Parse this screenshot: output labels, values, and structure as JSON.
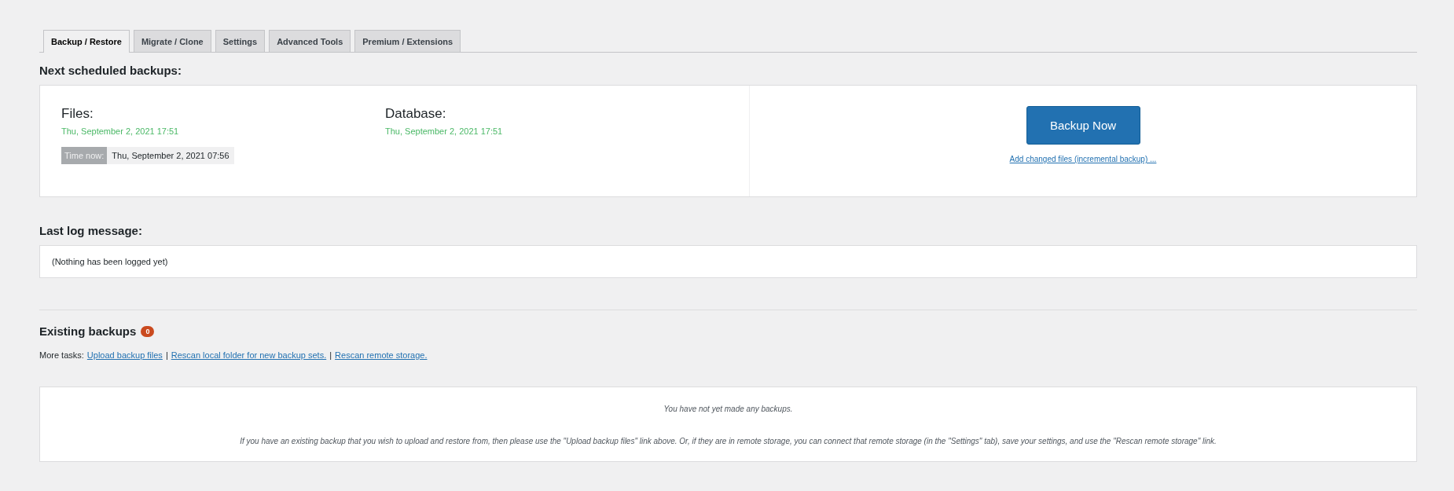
{
  "tabs": [
    {
      "label": "Backup / Restore",
      "selected": true
    },
    {
      "label": "Migrate / Clone",
      "selected": false
    },
    {
      "label": "Settings",
      "selected": false
    },
    {
      "label": "Advanced Tools",
      "selected": false
    },
    {
      "label": "Premium / Extensions",
      "selected": false
    }
  ],
  "next_scheduled": {
    "heading": "Next scheduled backups:",
    "files_label": "Files:",
    "files_time": "Thu, September 2, 2021 17:51",
    "database_label": "Database:",
    "database_time": "Thu, September 2, 2021 17:51",
    "time_now_label": "Time now:",
    "time_now_value": "Thu, September 2, 2021 07:56",
    "backup_button": "Backup Now",
    "incremental_link": "Add changed files (incremental backup) ..."
  },
  "last_log": {
    "heading": "Last log message:",
    "message": "(Nothing has been logged yet)"
  },
  "existing_backups": {
    "heading": "Existing backups",
    "count": "0",
    "more_tasks_label": "More tasks:",
    "links": [
      "Upload backup files",
      "Rescan local folder for new backup sets.",
      "Rescan remote storage."
    ],
    "separators": [
      "|",
      "|"
    ],
    "empty_message": "You have not yet made any backups.",
    "help_text": "If you have an existing backup that you wish to upload and restore from, then please use the \"Upload backup files\" link above. Or, if they are in remote storage, you can connect that remote storage (in the \"Settings\" tab), save your settings, and use the \"Rescan remote storage\" link."
  }
}
